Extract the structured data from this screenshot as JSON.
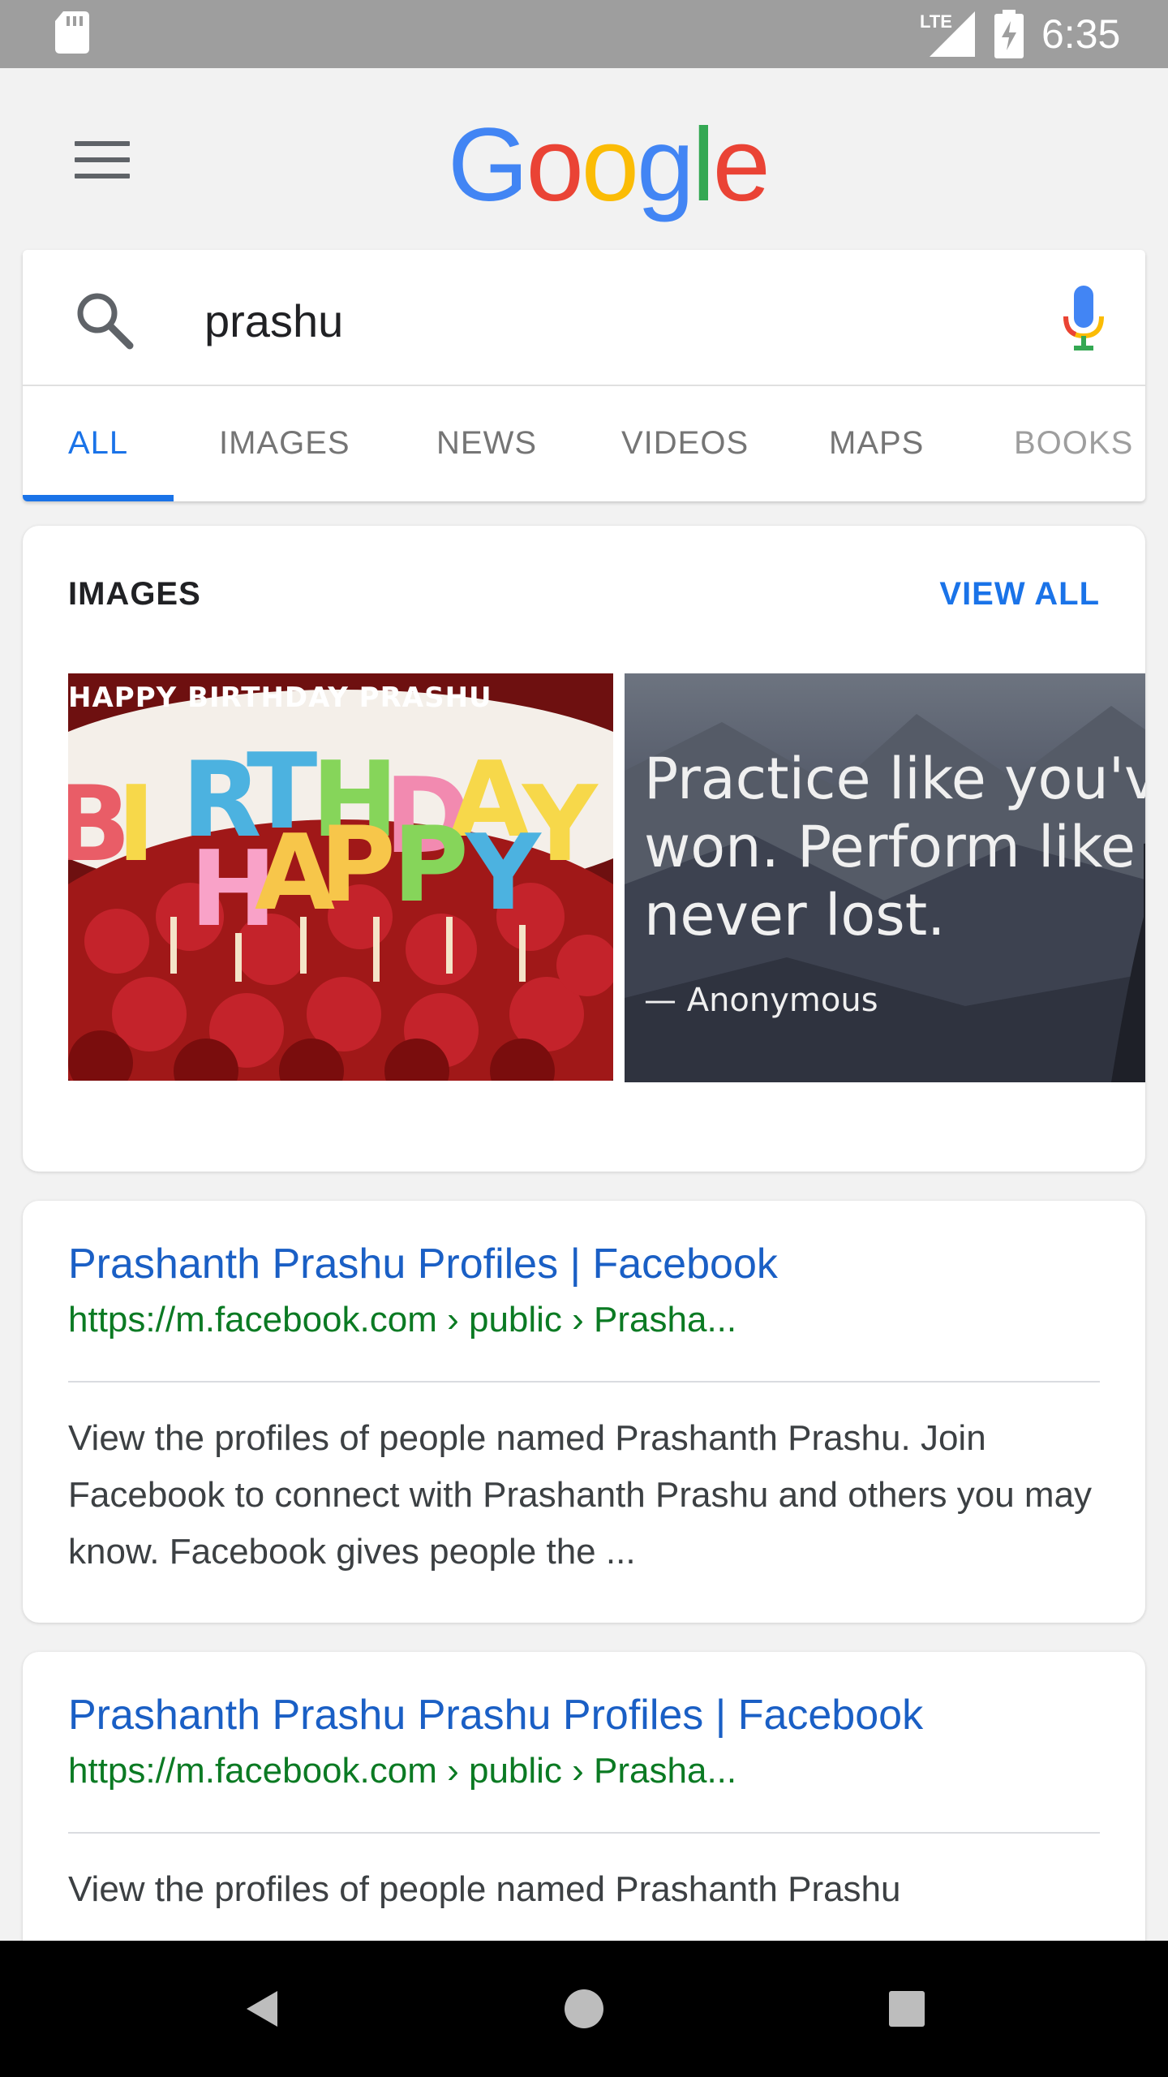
{
  "status_bar": {
    "time": "6:35",
    "network": "LTE",
    "icons": [
      "sd-card-icon",
      "lte-signal-icon",
      "battery-charging-icon"
    ]
  },
  "header": {
    "logo_letters": [
      {
        "char": "G",
        "color": "#4285F4"
      },
      {
        "char": "o",
        "color": "#EA4335"
      },
      {
        "char": "o",
        "color": "#FBBC05"
      },
      {
        "char": "g",
        "color": "#4285F4"
      },
      {
        "char": "l",
        "color": "#34A853"
      },
      {
        "char": "e",
        "color": "#EA4335"
      }
    ]
  },
  "search": {
    "query": "prashu"
  },
  "tabs": [
    {
      "label": "ALL",
      "active": true
    },
    {
      "label": "IMAGES",
      "active": false
    },
    {
      "label": "NEWS",
      "active": false
    },
    {
      "label": "VIDEOS",
      "active": false
    },
    {
      "label": "MAPS",
      "active": false
    },
    {
      "label": "BOOKS",
      "active": false
    }
  ],
  "images_section": {
    "title": "IMAGES",
    "view_all": "VIEW ALL",
    "image1": {
      "caption": "HAPPY BIRTHDAY PRASHU",
      "candle_letters": [
        "B",
        "I",
        "R",
        "T",
        "H",
        "D",
        "A",
        "Y",
        "H",
        "A",
        "P",
        "P",
        "Y"
      ]
    },
    "image2": {
      "quote": "Practice like you've never\nwon. Perform like you've\nnever lost.",
      "author": "— Anonymous"
    }
  },
  "results": [
    {
      "title": "Prashanth Prashu Profiles | Facebook",
      "url": "https://m.facebook.com › public › Prasha...",
      "snippet": "View the profiles of people named Prashanth Prashu. Join Facebook to connect with Prashanth Prashu and others you may know. Facebook gives people the ..."
    },
    {
      "title": "Prashanth Prashu Prashu Profiles | Facebook",
      "url": "https://m.facebook.com › public › Prasha...",
      "snippet": "View the profiles of people named Prashanth Prashu"
    }
  ],
  "colors": {
    "accent": "#1a73e8",
    "link": "#1a5fc5",
    "url_green": "#0b7a23",
    "status_bar": "#9e9e9e"
  },
  "nav_bar": {
    "buttons": [
      "back-icon",
      "home-icon",
      "recents-icon"
    ]
  }
}
